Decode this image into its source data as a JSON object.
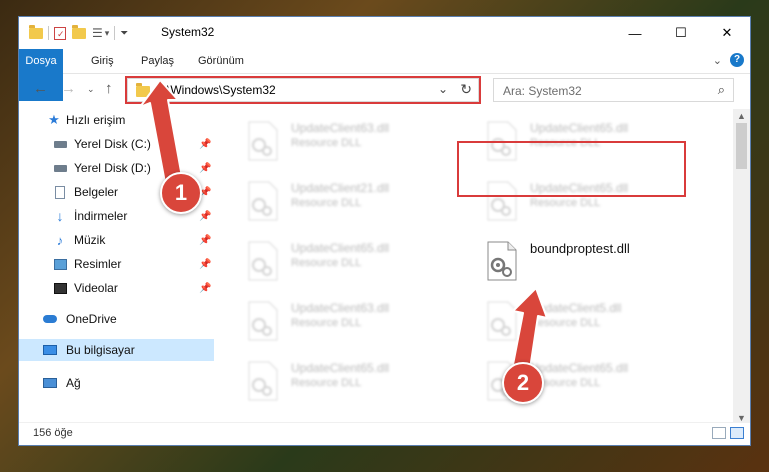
{
  "window": {
    "title": "System32",
    "controls": [
      "minimize",
      "maximize",
      "close"
    ]
  },
  "ribbon": {
    "tabs": [
      "Dosya",
      "Giriş",
      "Paylaş",
      "Görünüm"
    ],
    "expand_icon": "chevron-down",
    "help_label": "?"
  },
  "address": {
    "path": "C:\\Windows\\System32",
    "search_placeholder": "Ara: System32"
  },
  "nav": {
    "quick_access": "Hızlı erişim",
    "items": [
      {
        "label": "Yerel Disk (C:)",
        "icon": "drive-icon",
        "pinned": true
      },
      {
        "label": "Yerel Disk (D:)",
        "icon": "drive-icon",
        "pinned": true
      },
      {
        "label": "Belgeler",
        "icon": "documents-icon",
        "pinned": true
      },
      {
        "label": "İndirmeler",
        "icon": "downloads-icon",
        "pinned": true
      },
      {
        "label": "Müzik",
        "icon": "music-icon",
        "pinned": true
      },
      {
        "label": "Resimler",
        "icon": "pictures-icon",
        "pinned": true
      },
      {
        "label": "Videolar",
        "icon": "videos-icon",
        "pinned": true
      }
    ],
    "onedrive": "OneDrive",
    "this_pc": "Bu bilgisayar",
    "network": "Ağ"
  },
  "files": [
    {
      "name": "UpdateClient63.dll",
      "desc": "Resource DLL"
    },
    {
      "name": "UpdateClient65.dll",
      "desc": "Resource DLL"
    },
    {
      "name": "UpdateClient21.dll",
      "desc": "Resource DLL"
    },
    {
      "name": "UpdateClient65.dll",
      "desc": "Resource DLL"
    },
    {
      "name": "UpdateClient65.dll",
      "desc": "Resource DLL"
    },
    {
      "name": "boundproptest.dll",
      "desc": ""
    },
    {
      "name": "UpdateClient63.dll",
      "desc": "Resource DLL"
    },
    {
      "name": "UpdateClient5.dll",
      "desc": "Resource DLL"
    },
    {
      "name": "UpdateClient65.dll",
      "desc": "Resource DLL"
    },
    {
      "name": "UpdateClient65.dll",
      "desc": "Resource DLL"
    }
  ],
  "status": {
    "count": "156 öğe"
  },
  "annotations": {
    "step1": "1",
    "step2": "2",
    "highlight_color": "#d93b3b"
  },
  "colors": {
    "accent": "#1979ca",
    "selection": "#cce8ff"
  }
}
